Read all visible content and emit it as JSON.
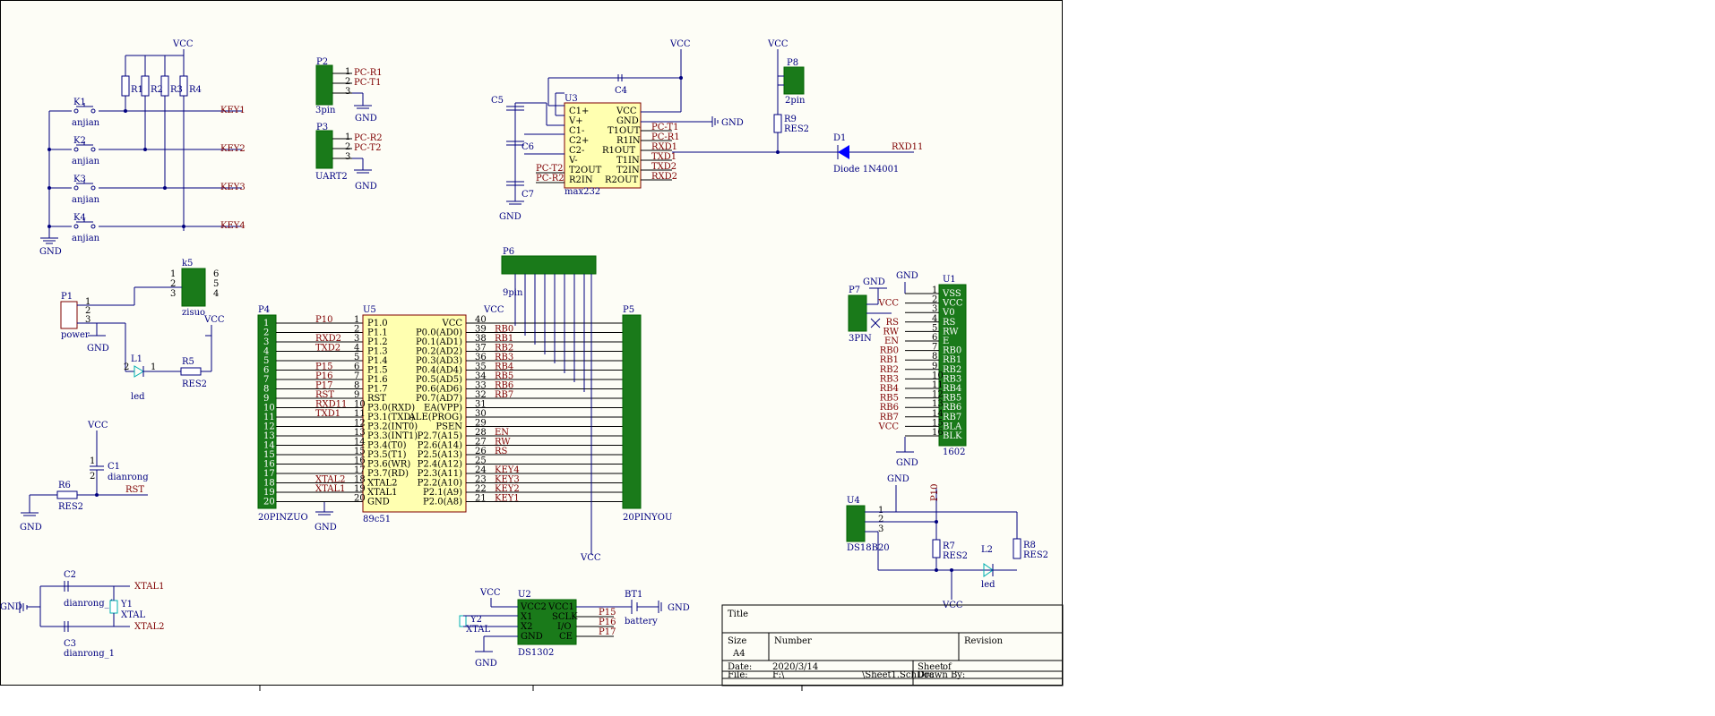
{
  "power": {
    "vcc": "VCC",
    "gnd": "GND"
  },
  "keys": {
    "resistors": [
      "R1",
      "R2",
      "R3",
      "R4"
    ],
    "switches": [
      "K1",
      "K2",
      "K3",
      "K4"
    ],
    "switch_value": "anjian",
    "nets": [
      "KEY1",
      "KEY2",
      "KEY3",
      "KEY4"
    ]
  },
  "p2": {
    "des": "P2",
    "pins": [
      "1",
      "2",
      "3"
    ],
    "nets": [
      "PC-R1",
      "PC-T1"
    ],
    "value": "3pin"
  },
  "p3": {
    "des": "P3",
    "pins": [
      "1",
      "2",
      "3"
    ],
    "nets": [
      "PC-R2",
      "PC-T2"
    ],
    "value": "UART2"
  },
  "u3": {
    "des": "U3",
    "value": "max232",
    "left_pins": [
      "C1+",
      "V+",
      "C1-",
      "C2+",
      "C2-",
      "V-",
      "T2OUT",
      "R2IN"
    ],
    "right_pins": [
      "VCC",
      "GND",
      "T1OUT",
      "R1IN",
      "R1OUT",
      "T1IN",
      "T2IN",
      "R2OUT"
    ],
    "right_nets": [
      "PC-T1",
      "PC-R1",
      "RXD1",
      "TXD1",
      "TXD2",
      "RXD2"
    ],
    "left_nets": [
      "PC-T2",
      "PC-R2"
    ],
    "caps": [
      "C4",
      "C5",
      "C6",
      "C7"
    ]
  },
  "p8": {
    "des": "P8",
    "value": "2pin"
  },
  "r9": {
    "des": "R9",
    "value": "RES2"
  },
  "d1": {
    "des": "D1",
    "value": "Diode 1N4001",
    "net": "RXD11"
  },
  "k5": {
    "des": "k5",
    "value": "zisuo",
    "pins": [
      "1",
      "2",
      "3",
      "4",
      "5",
      "6"
    ]
  },
  "p1": {
    "des": "P1",
    "value": "power",
    "pins": [
      "1",
      "2",
      "3"
    ]
  },
  "l1": {
    "des": "L1",
    "value": "led",
    "pins": [
      "2",
      "1"
    ]
  },
  "r5": {
    "des": "R5",
    "value": "RES2"
  },
  "c1": {
    "des": "C1",
    "value": "dianrong",
    "pins": [
      "1",
      "2"
    ]
  },
  "r6": {
    "des": "R6",
    "value": "RES2",
    "net": "RST"
  },
  "p4": {
    "des": "P4",
    "value": "20PINZUO",
    "nets": [
      "P10",
      "",
      "RXD2",
      "TXD2",
      "",
      "P15",
      "P16",
      "P17",
      "RST",
      "RXD11",
      "TXD1",
      "",
      "",
      "",
      "",
      "",
      "",
      "XTAL2",
      "XTAL1",
      ""
    ]
  },
  "u5": {
    "des": "U5",
    "value": "89c51",
    "left_pins": [
      "P1.0",
      "P1.1",
      "P1.2",
      "P1.3",
      "P1.4",
      "P1.5",
      "P1.6",
      "P1.7",
      "RST",
      "P3.0(RXD)",
      "P3.1(TXD)",
      "P3.2(INT0)",
      "P3.3(INT1)",
      "P3.4(T0)",
      "P3.5(T1)",
      "P3.6(WR)",
      "P3.7(RD)",
      "XTAL2",
      "XTAL1",
      "GND"
    ],
    "left_nums": [
      "1",
      "2",
      "3",
      "4",
      "5",
      "6",
      "7",
      "8",
      "9",
      "10",
      "11",
      "12",
      "13",
      "14",
      "15",
      "16",
      "17",
      "18",
      "19",
      "20"
    ],
    "right_pins": [
      "VCC",
      "P0.0(AD0)",
      "P0.1(AD1)",
      "P0.2(AD2)",
      "P0.3(AD3)",
      "P0.4(AD4)",
      "P0.5(AD5)",
      "P0.6(AD6)",
      "P0.7(AD7)",
      "EA(VPP)",
      "ALE(PROG)",
      "PSEN",
      "P2.7(A15)",
      "P2.6(A14)",
      "P2.5(A13)",
      "P2.4(A12)",
      "P2.3(A11)",
      "P2.2(A10)",
      "P2.1(A9)",
      "P2.0(A8)"
    ],
    "right_nums": [
      "40",
      "39",
      "38",
      "37",
      "36",
      "35",
      "34",
      "33",
      "32",
      "31",
      "30",
      "29",
      "28",
      "27",
      "26",
      "25",
      "24",
      "23",
      "22",
      "21"
    ],
    "right_nets": [
      "",
      "RB0",
      "RB1",
      "RB2",
      "RB3",
      "RB4",
      "RB5",
      "RB6",
      "RB7",
      "",
      "",
      "",
      "EN",
      "RW",
      "RS",
      "",
      "KEY4",
      "KEY3",
      "KEY2",
      "KEY1"
    ]
  },
  "p5": {
    "des": "P5",
    "value": "20PINYOU"
  },
  "p6": {
    "des": "P6",
    "value": "9pin"
  },
  "p7": {
    "des": "P7",
    "value": "3PIN"
  },
  "u1": {
    "des": "U1",
    "value": "1602",
    "pins": [
      "VSS",
      "VCC",
      "V0",
      "RS",
      "RW",
      "E",
      "RB0",
      "RB1",
      "RB2",
      "RB3",
      "RB4",
      "RB5",
      "RB6",
      "RB7",
      "BLA",
      "BLK"
    ],
    "nets": [
      "",
      "VCC",
      "",
      "RS",
      "RW",
      "EN",
      "RB0",
      "RB1",
      "RB2",
      "RB3",
      "RB4",
      "RB5",
      "RB6",
      "RB7",
      "VCC",
      ""
    ]
  },
  "u4": {
    "des": "U4",
    "value": "DS18B20",
    "net": "P10"
  },
  "r7": {
    "des": "R7",
    "value": "RES2"
  },
  "r8": {
    "des": "R8",
    "value": "RES2"
  },
  "l2": {
    "des": "L2",
    "value": "led"
  },
  "xtal": {
    "c2": "C2",
    "c3": "C3",
    "cap_value": "dianrong_1",
    "y1": "Y1",
    "y1_value": "XTAL",
    "nets": [
      "XTAL1",
      "XTAL2"
    ]
  },
  "u2": {
    "des": "U2",
    "value": "DS1302",
    "left_pins": [
      "VCC2",
      "X1",
      "X2",
      "GND"
    ],
    "right_pins": [
      "VCC1",
      "SCLK",
      "I/O",
      "CE"
    ],
    "nets": [
      "P15",
      "P16",
      "P17"
    ],
    "y2": "Y2",
    "y2_value": "XTAL"
  },
  "bt1": {
    "des": "BT1",
    "value": "battery"
  },
  "title_block": {
    "title": "Title",
    "size_label": "Size",
    "size": "A4",
    "number_label": "Number",
    "revision_label": "Revision",
    "date_label": "Date:",
    "date": "2020/3/14",
    "sheet_label": "Sheet",
    "of_label": "of",
    "file_label": "File:",
    "file": "F:\\",
    "file2": "\\Sheet1.SchDoc",
    "drawn_label": "Drawn By:"
  }
}
